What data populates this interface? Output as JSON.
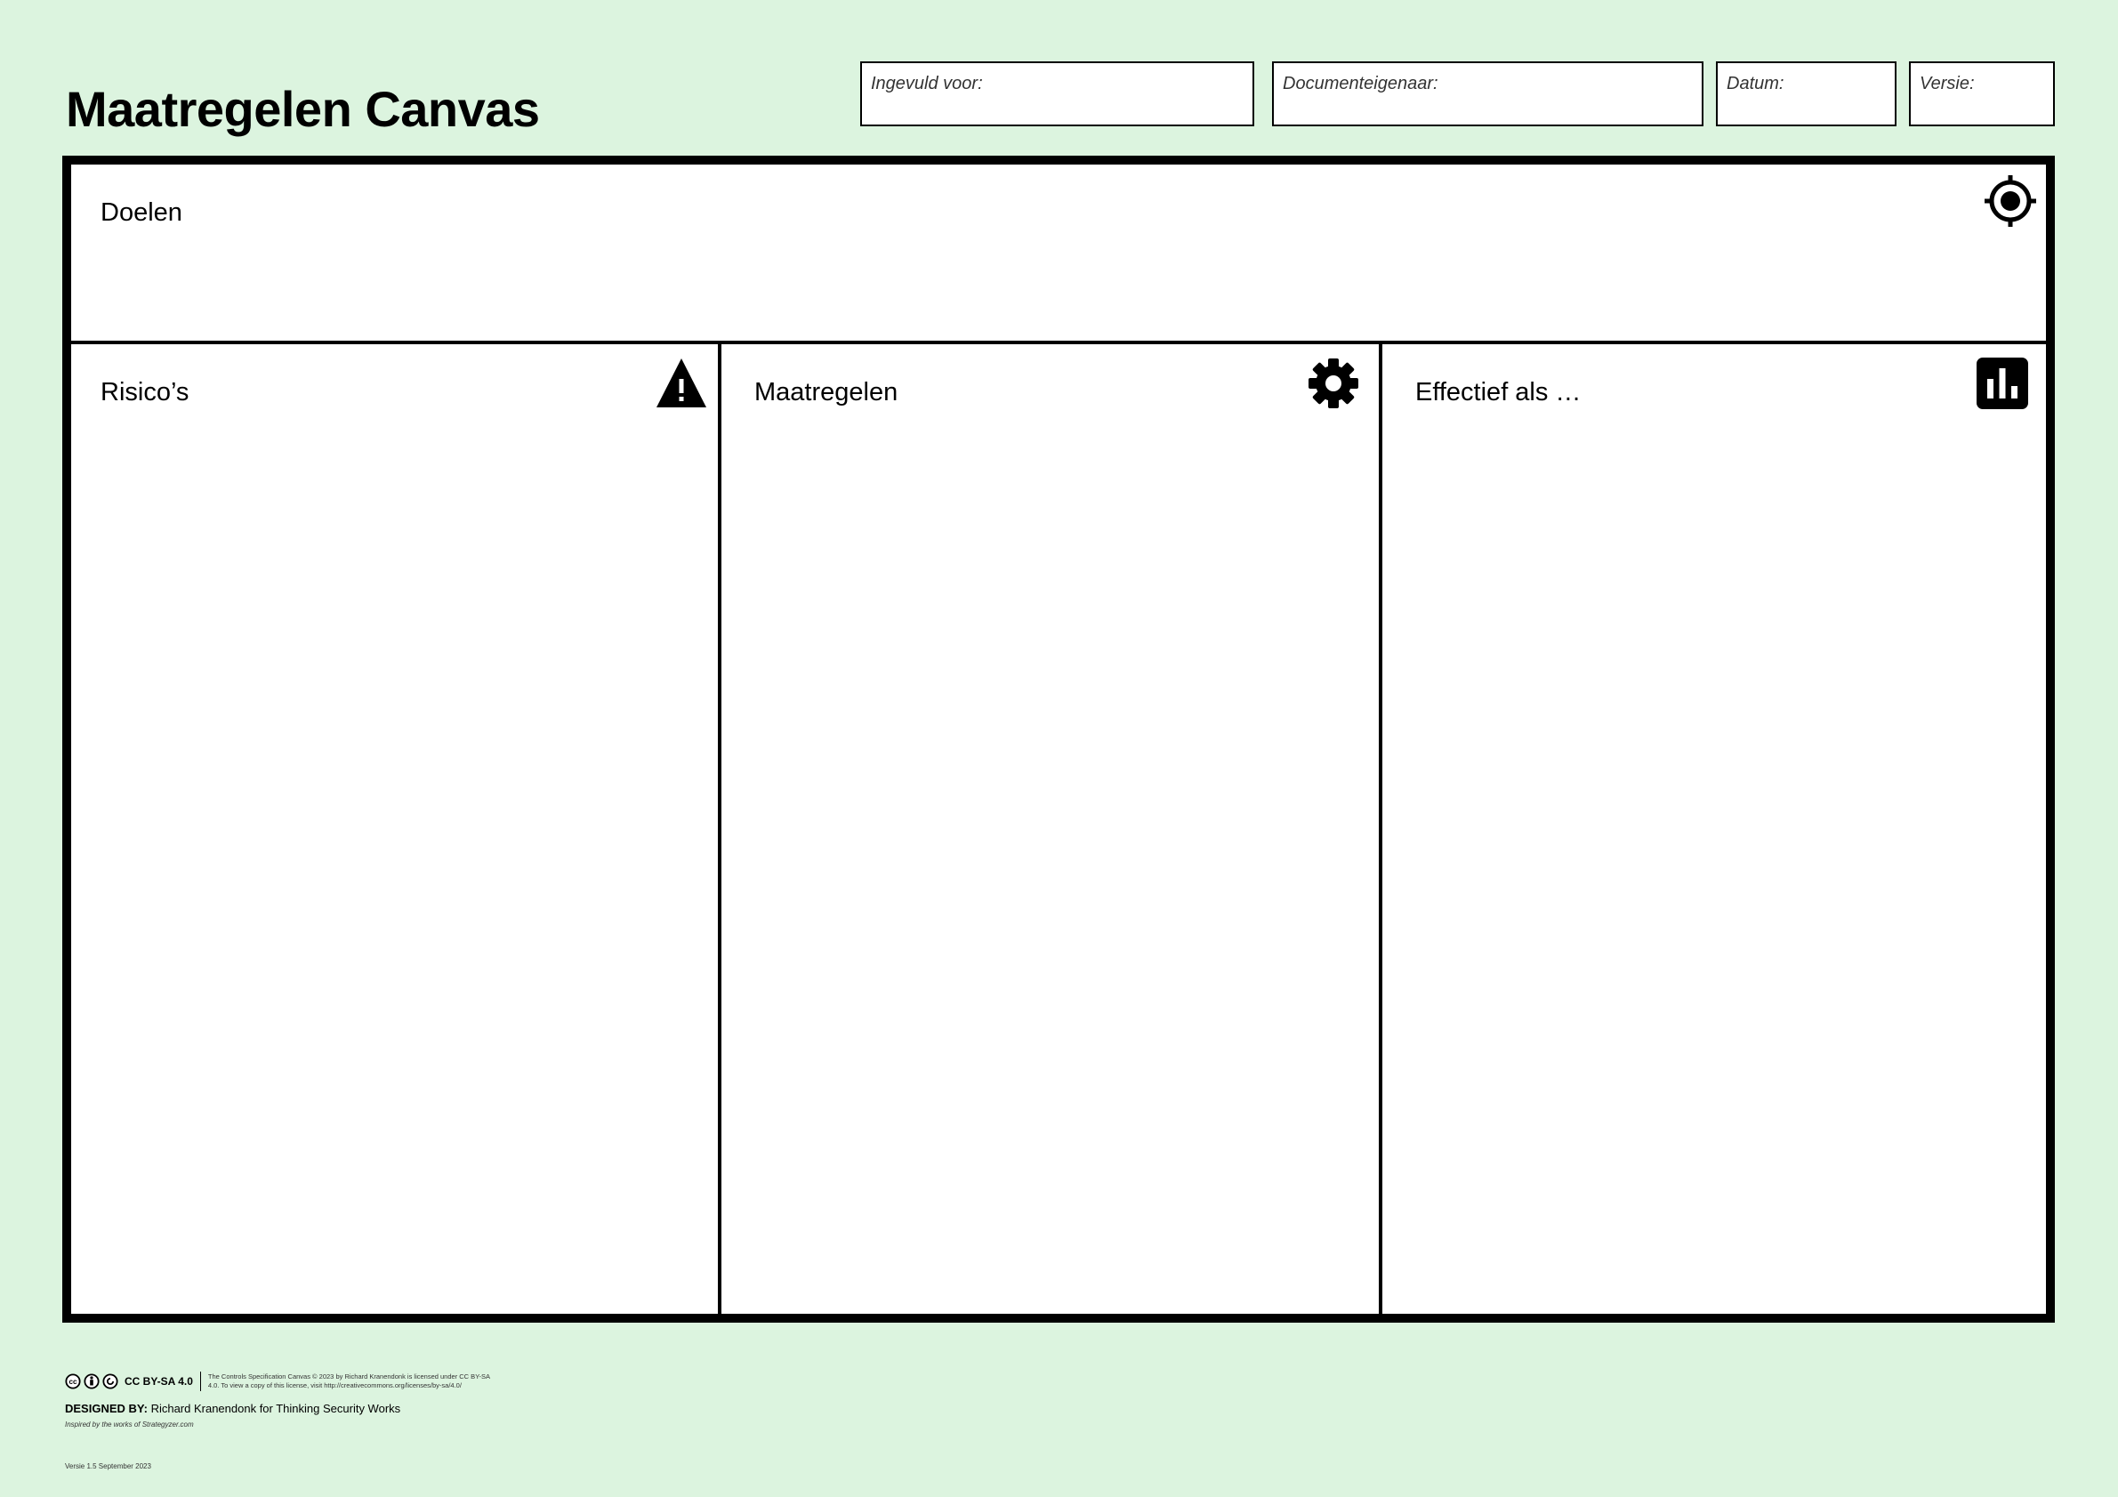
{
  "title": "Maatregelen Canvas",
  "header_fields": {
    "ingevuld_voor": "Ingevuld voor:",
    "documenteigenaar": "Documenteigenaar:",
    "datum": "Datum:",
    "versie": "Versie:"
  },
  "panels": {
    "doelen": {
      "label": "Doelen",
      "icon": "target-icon"
    },
    "risicos": {
      "label": "Risico’s",
      "icon": "warning-icon"
    },
    "maatregelen": {
      "label": "Maatregelen",
      "icon": "gear-icon"
    },
    "effectief": {
      "label": "Effectief als …",
      "icon": "bar-chart-icon"
    }
  },
  "footer": {
    "cc_badge": "CC BY-SA 4.0",
    "license_text": "The Controls Specification Canvas © 2023 by Richard Kranendonk is licensed under CC BY-SA 4.0. To view a copy of this license, visit http://creativecommons.org/licenses/by-sa/4.0/",
    "designed_by_label": "DESIGNED BY:",
    "designed_by_value": "Richard Kranendonk for Thinking Security Works",
    "inspired": "Inspired by the works of Strategyzer.com",
    "version": "Versie 1.5 September 2023"
  },
  "colors": {
    "background": "#dcf4df",
    "ink": "#000000"
  }
}
